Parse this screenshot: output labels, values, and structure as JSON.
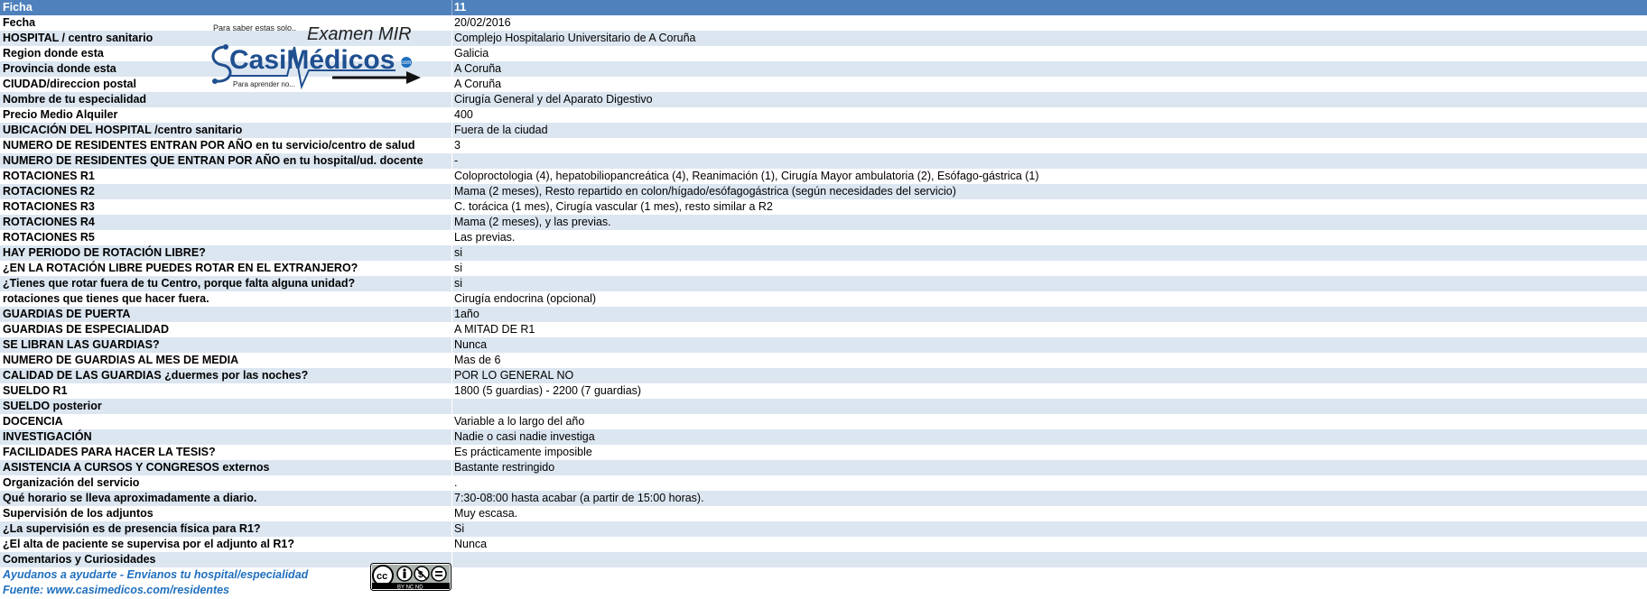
{
  "header": {
    "label": "Ficha",
    "value": "11"
  },
  "rows": [
    {
      "label": "Fecha",
      "value": "20/02/2016"
    },
    {
      "label": "HOSPITAL / centro sanitario",
      "value": "Complejo Hospitalario Universitario de A Coruña"
    },
    {
      "label": "Region donde esta",
      "value": "Galicia"
    },
    {
      "label": "Provincia donde esta",
      "value": "A Coruña"
    },
    {
      "label": "CIUDAD/direccion postal",
      "value": "A Coruña"
    },
    {
      "label": "Nombre de tu especialidad",
      "value": "Cirugía General y del Aparato Digestivo"
    },
    {
      "label": "Precio Medio Alquiler",
      "value": "400"
    },
    {
      "label": "UBICACIÓN DEL HOSPITAL /centro sanitario",
      "value": "Fuera de la ciudad"
    },
    {
      "label": "NUMERO DE RESIDENTES ENTRAN POR AÑO en tu servicio/centro de salud",
      "value": "3"
    },
    {
      "label": "NUMERO DE RESIDENTES QUE ENTRAN POR AÑO en tu hospital/ud. docente",
      "value": "-"
    },
    {
      "label": "ROTACIONES R1",
      "value": "Coloproctologia (4), hepatobiliopancreática (4), Reanimación (1), Cirugía Mayor ambulatoria (2), Esófago-gástrica (1)"
    },
    {
      "label": "ROTACIONES R2",
      "value": "Mama (2 meses), Resto repartido en colon/hígado/esófagogástrica (según necesidades del servicio)"
    },
    {
      "label": "ROTACIONES R3",
      "value": "C. torácica (1 mes), Cirugía vascular (1 mes), resto similar a R2"
    },
    {
      "label": "ROTACIONES R4",
      "value": "Mama (2 meses), y las previas."
    },
    {
      "label": "ROTACIONES R5",
      "value": "Las previas."
    },
    {
      "label": "HAY PERIODO DE ROTACIÓN LIBRE?",
      "value": "si"
    },
    {
      "label": "¿EN LA ROTACIÓN LIBRE PUEDES ROTAR EN EL EXTRANJERO?",
      "value": "si"
    },
    {
      "label": "¿Tienes que rotar fuera de tu Centro, porque falta alguna unidad?",
      "value": "si"
    },
    {
      "label": "rotaciones que tienes que hacer fuera.",
      "value": "Cirugía endocrina (opcional)"
    },
    {
      "label": "GUARDIAS DE PUERTA",
      "value": "1año"
    },
    {
      "label": "GUARDIAS DE ESPECIALIDAD",
      "value": "A MITAD DE R1"
    },
    {
      "label": " SE LIBRAN LAS GUARDIAS?",
      "value": "Nunca"
    },
    {
      "label": "NUMERO DE GUARDIAS AL MES DE MEDIA",
      "value": "Mas de 6"
    },
    {
      "label": "CALIDAD DE LAS GUARDIAS ¿duermes por las noches?",
      "value": "POR LO GENERAL NO"
    },
    {
      "label": "SUELDO R1",
      "value": "1800 (5 guardias) - 2200 (7 guardias)"
    },
    {
      "label": "SUELDO posterior",
      "value": ""
    },
    {
      "label": "DOCENCIA",
      "value": "Variable a lo largo del año"
    },
    {
      "label": "INVESTIGACIÓN",
      "value": "Nadie o casi nadie investiga"
    },
    {
      "label": "FACILIDADES PARA HACER LA TESIS?",
      "value": "Es prácticamente imposible"
    },
    {
      "label": "ASISTENCIA A CURSOS Y CONGRESOS externos",
      "value": "Bastante restringido"
    },
    {
      "label": "Organización del servicio",
      "value": "."
    },
    {
      "label": "Qué horario se lleva aproximadamente a diario.",
      "value": "7:30-08:00 hasta acabar (a partir de 15:00 horas)."
    },
    {
      "label": "Supervisión de los adjuntos",
      "value": "Muy escasa."
    },
    {
      "label": "¿La supervisión es de presencia física para R1?",
      "value": "Si"
    },
    {
      "label": "¿El alta de paciente se supervisa por el adjunto al R1?",
      "value": "Nunca"
    },
    {
      "label": "Comentarios y Curiosidades",
      "value": ""
    }
  ],
  "footer": [
    {
      "label": "Ayudanos a ayudarte - Envianos tu hospital/especialidad"
    },
    {
      "label": "Fuente: www.casimedicos.com/residentes"
    }
  ],
  "logo": {
    "tagline_top": "Para saber estas solo..",
    "exam": "Examen MIR",
    "brand": "CasiMédicos",
    "brand_suffix": "com",
    "tagline_bottom": "Para aprender no...",
    "brand_color": "#1f6fbf"
  },
  "license": {
    "badge": "BY NC ND"
  },
  "colors": {
    "header_bg": "#4f81bd",
    "band_bg": "#dce6f1",
    "footer_text": "#1f6fbf"
  }
}
